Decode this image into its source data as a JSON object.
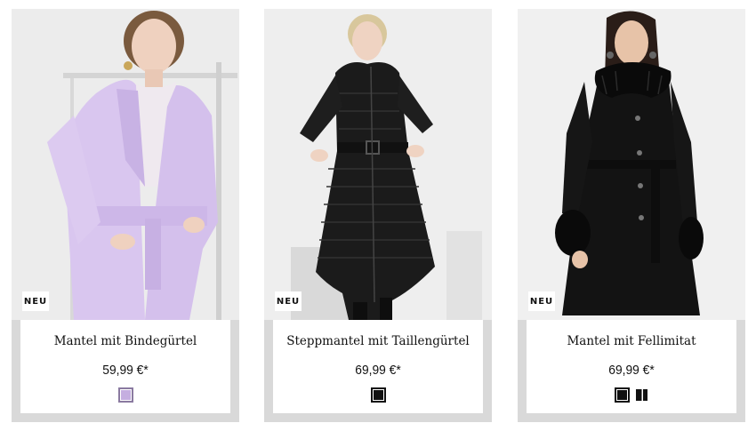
{
  "products": [
    {
      "badge": "NEU",
      "name": "Mantel mit Bindegürtel",
      "price": "59,99 €*",
      "swatches": [
        {
          "color": "#c5aee0",
          "selected": true
        }
      ]
    },
    {
      "badge": "NEU",
      "name": "Steppmantel mit Taillengürtel",
      "price": "69,99 €*",
      "swatches": [
        {
          "color": "#111111",
          "selected": true
        }
      ]
    },
    {
      "badge": "NEU",
      "name": "Mantel mit Fellimitat",
      "price": "69,99 €*",
      "swatches": [
        {
          "color": "#111111",
          "selected": true
        },
        {
          "color": "split-black-white",
          "selected": false
        }
      ]
    }
  ],
  "colors": {
    "card_frame": "#d9d9d9",
    "info_bg": "#ffffff",
    "text": "#111111"
  }
}
